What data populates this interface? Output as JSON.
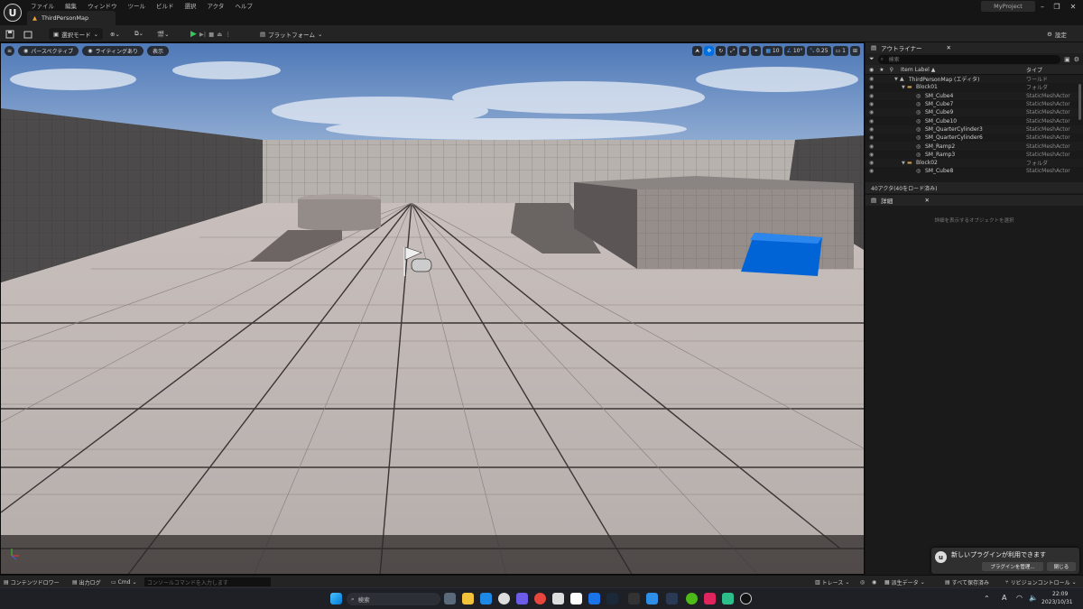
{
  "menu": [
    "ファイル",
    "編集",
    "ウィンドウ",
    "ツール",
    "ビルド",
    "選択",
    "アクタ",
    "ヘルプ"
  ],
  "tab_title": "ThirdPersonMap",
  "project_name": "MyProject",
  "toolbar": {
    "mode": "選択モード",
    "platform": "プラットフォーム",
    "settings": "設定"
  },
  "viewport": {
    "perspective": "パースペクティブ",
    "lighting": "ライティングあり",
    "show": "表示",
    "grid_snap": "10",
    "rot_snap": "10°",
    "scale_snap": "0.25",
    "camera_speed": "1"
  },
  "outliner": {
    "tab": "アウトライナー",
    "search_placeholder": "検索",
    "col_label": "Item Label ▲",
    "col_type": "タイプ",
    "rows": [
      {
        "label": "ThirdPersonMap (エディタ)",
        "type": "ワールド",
        "indent": 1,
        "icon": "world"
      },
      {
        "label": "Block01",
        "type": "フォルダ",
        "indent": 2,
        "icon": "folder"
      },
      {
        "label": "SM_Cube4",
        "type": "StaticMeshActor",
        "indent": 3,
        "icon": "mesh"
      },
      {
        "label": "SM_Cube7",
        "type": "StaticMeshActor",
        "indent": 3,
        "icon": "mesh"
      },
      {
        "label": "SM_Cube9",
        "type": "StaticMeshActor",
        "indent": 3,
        "icon": "mesh"
      },
      {
        "label": "SM_Cube10",
        "type": "StaticMeshActor",
        "indent": 3,
        "icon": "mesh"
      },
      {
        "label": "SM_QuarterCylinder3",
        "type": "StaticMeshActor",
        "indent": 3,
        "icon": "mesh"
      },
      {
        "label": "SM_QuarterCylinder6",
        "type": "StaticMeshActor",
        "indent": 3,
        "icon": "mesh"
      },
      {
        "label": "SM_Ramp2",
        "type": "StaticMeshActor",
        "indent": 3,
        "icon": "mesh"
      },
      {
        "label": "SM_Ramp3",
        "type": "StaticMeshActor",
        "indent": 3,
        "icon": "mesh"
      },
      {
        "label": "Block02",
        "type": "フォルダ",
        "indent": 2,
        "icon": "folder"
      },
      {
        "label": "SM_Cube8",
        "type": "StaticMeshActor",
        "indent": 3,
        "icon": "mesh"
      }
    ],
    "footer": "40アクタ(40をロード済み)"
  },
  "details": {
    "tab": "詳細",
    "empty": "詳細を表示するオブジェクトを選択"
  },
  "notification": {
    "title": "新しいプラグインが利用できます",
    "manage": "プラグインを管理...",
    "close": "閉じる"
  },
  "statusbar": {
    "content_drawer": "コンテンツドロワー",
    "output_log": "出力ログ",
    "cmd": "Cmd",
    "console_placeholder": "コンソールコマンドを入力します",
    "trace": "トレース",
    "derived_data": "派生データ",
    "save_all": "すべて保存済み",
    "revision": "リビジョンコントロール"
  },
  "taskbar": {
    "search": "検索",
    "time": "22:09",
    "date": "2023/10/31",
    "ime": "A"
  },
  "colors": {
    "accent_blue": "#0070e0",
    "play_green": "#34c759"
  }
}
